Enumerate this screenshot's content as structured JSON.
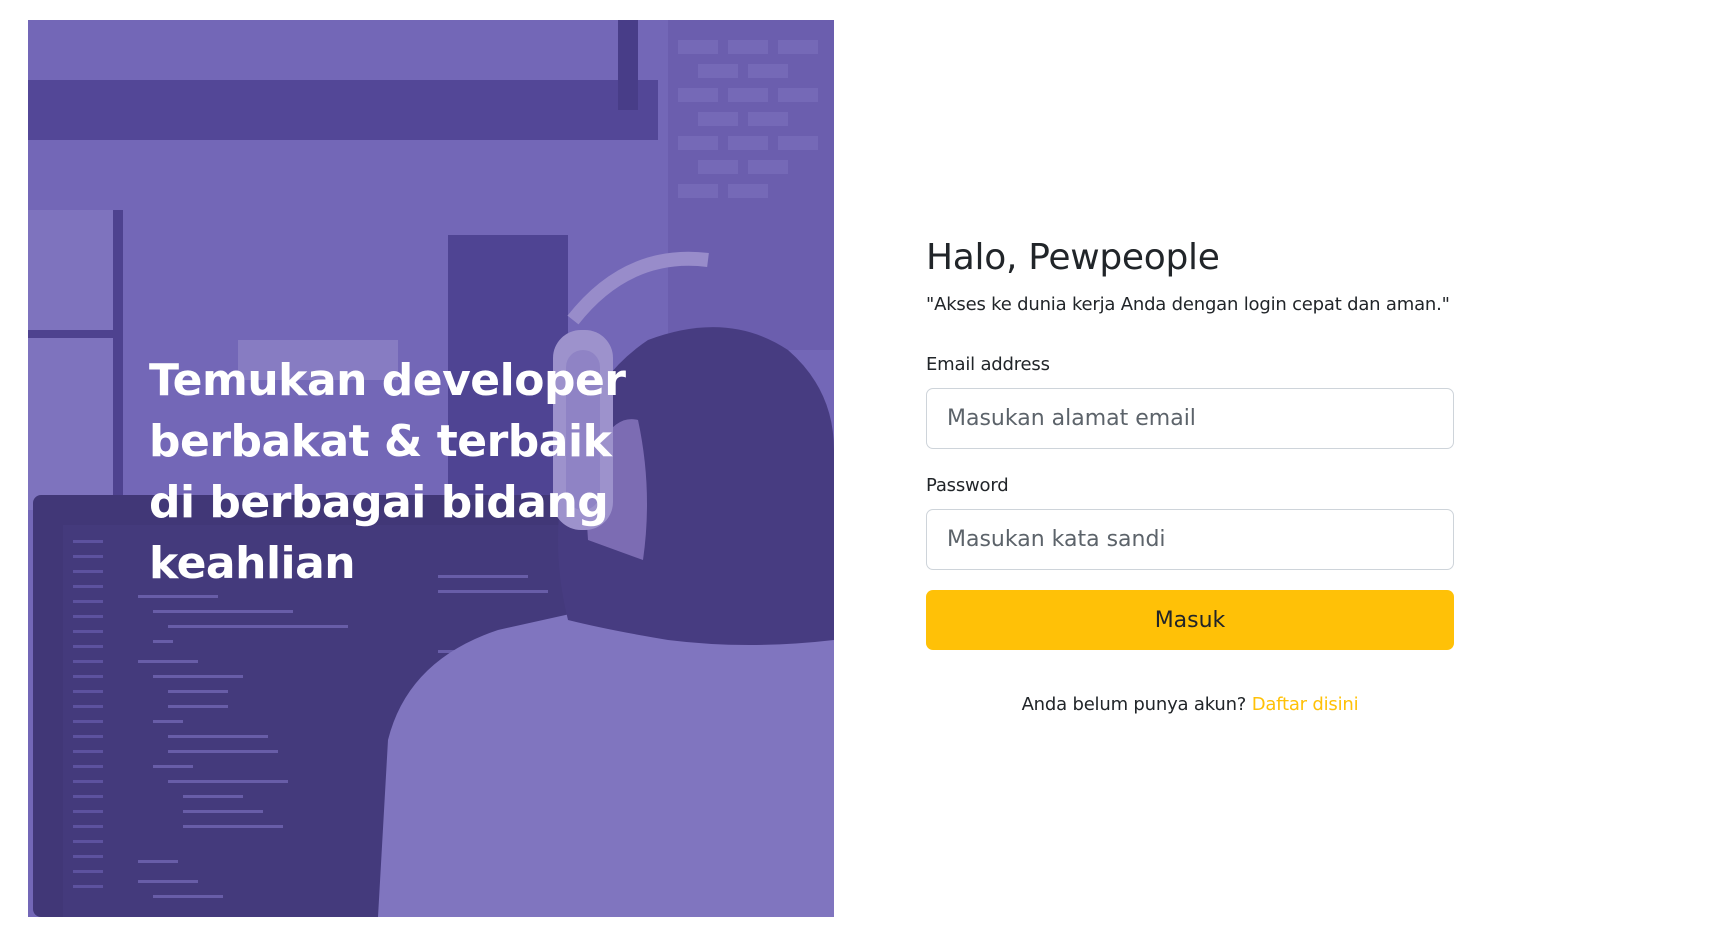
{
  "hero": {
    "headline": "Temukan developer berbakat & terbaik di berbagai bidang keahlian",
    "overlay_color": "#5e50aa"
  },
  "login": {
    "title": "Halo, Pewpeople",
    "subtitle": "\"Akses ke dunia kerja Anda dengan login cepat dan aman.\"",
    "email_label": "Email address",
    "email_value": "",
    "email_placeholder": "Masukan alamat email",
    "password_label": "Password",
    "password_value": "",
    "password_placeholder": "Masukan kata sandi",
    "submit_label": "Masuk",
    "signup_prompt": "Anda belum punya akun?",
    "signup_link": "Daftar disini"
  },
  "colors": {
    "accent": "#ffc107",
    "text": "#212529",
    "input_border": "#ced4da"
  }
}
